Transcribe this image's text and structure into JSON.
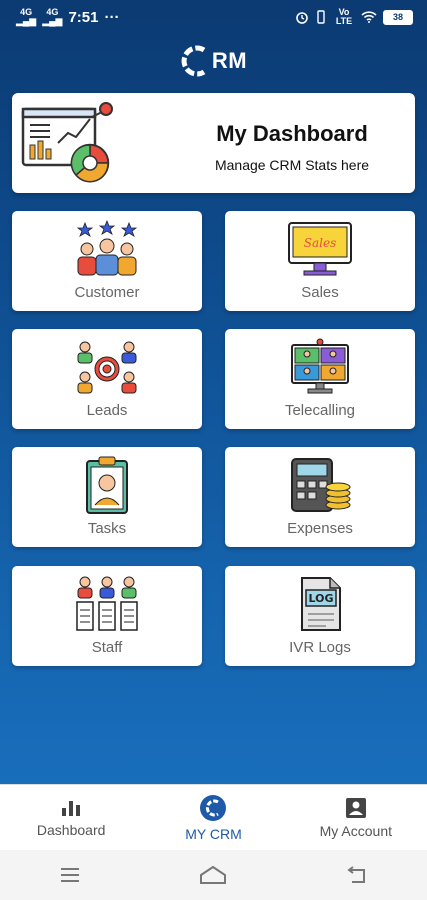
{
  "status_bar": {
    "net1": "4G",
    "net2": "4G",
    "time": "7:51",
    "more": "···",
    "volte": "Vo LTE",
    "battery": "38"
  },
  "header": {
    "logo_text": "RM"
  },
  "dashboard_card": {
    "title": "My Dashboard",
    "subtitle": "Manage CRM Stats here"
  },
  "tiles": [
    {
      "label": "Customer",
      "icon": "customers-icon"
    },
    {
      "label": "Sales",
      "icon": "sales-monitor-icon"
    },
    {
      "label": "Leads",
      "icon": "leads-target-icon"
    },
    {
      "label": "Telecalling",
      "icon": "telecalling-icon"
    },
    {
      "label": "Tasks",
      "icon": "tasks-clipboard-icon"
    },
    {
      "label": "Expenses",
      "icon": "calculator-coins-icon"
    },
    {
      "label": "Staff",
      "icon": "staff-icon"
    },
    {
      "label": "IVR Logs",
      "icon": "log-file-icon"
    }
  ],
  "sales_sign_text": "Sales",
  "log_text": "LOG",
  "bottom_nav": [
    {
      "label": "Dashboard",
      "icon": "bar-chart-icon",
      "active": false
    },
    {
      "label": "MY CRM",
      "icon": "crm-logo-icon",
      "active": true
    },
    {
      "label": "My Account",
      "icon": "account-icon",
      "active": false
    }
  ],
  "colors": {
    "primary": "#1e5aa8",
    "bg_top": "#0c3a72",
    "bg_bottom": "#1a74c3"
  }
}
